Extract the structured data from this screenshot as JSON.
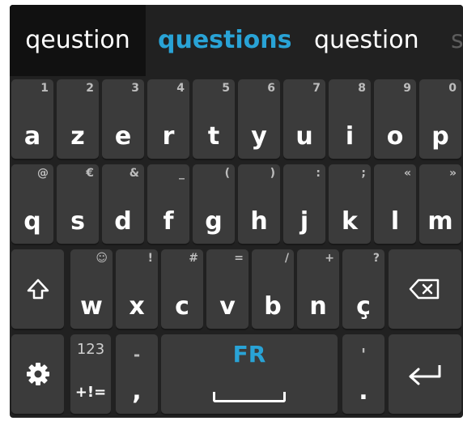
{
  "suggestions": {
    "typed": "qeustion",
    "best": "questions",
    "alternate": "question",
    "more": "s"
  },
  "rows": [
    [
      {
        "label": "a",
        "hint": "1"
      },
      {
        "label": "z",
        "hint": "2"
      },
      {
        "label": "e",
        "hint": "3"
      },
      {
        "label": "r",
        "hint": "4"
      },
      {
        "label": "t",
        "hint": "5"
      },
      {
        "label": "y",
        "hint": "6"
      },
      {
        "label": "u",
        "hint": "7"
      },
      {
        "label": "i",
        "hint": "8"
      },
      {
        "label": "o",
        "hint": "9"
      },
      {
        "label": "p",
        "hint": "0"
      }
    ],
    [
      {
        "label": "q",
        "hint": "@"
      },
      {
        "label": "s",
        "hint": "€"
      },
      {
        "label": "d",
        "hint": "&"
      },
      {
        "label": "f",
        "hint": "_"
      },
      {
        "label": "g",
        "hint": "("
      },
      {
        "label": "h",
        "hint": ")"
      },
      {
        "label": "j",
        "hint": ":"
      },
      {
        "label": "k",
        "hint": ";"
      },
      {
        "label": "l",
        "hint": "«"
      },
      {
        "label": "m",
        "hint": "»"
      }
    ],
    [
      {
        "label": "w",
        "hint": "☺"
      },
      {
        "label": "x",
        "hint": "!"
      },
      {
        "label": "c",
        "hint": "#"
      },
      {
        "label": "v",
        "hint": "="
      },
      {
        "label": "b",
        "hint": "/"
      },
      {
        "label": "n",
        "hint": "+"
      },
      {
        "label": "ç",
        "hint": "?"
      }
    ]
  ],
  "bottom": {
    "symbols_top": "123",
    "symbols_bottom": "+!=",
    "dash_key": {
      "hint": "-",
      "label": ","
    },
    "space_label": "FR",
    "period_key": {
      "hint": "'",
      "label": "."
    }
  },
  "icons": {
    "shift": "shift-arrow-icon",
    "backspace": "backspace-icon",
    "settings": "gear-icon",
    "enter": "enter-icon"
  },
  "colors": {
    "background": "#212121",
    "key": "#3b3b3b",
    "accent": "#29a3d6",
    "typed_bg": "#111111"
  }
}
